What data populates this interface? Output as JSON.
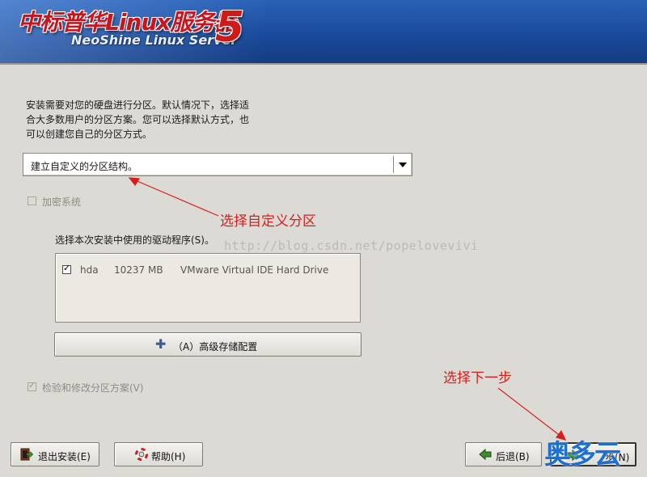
{
  "header": {
    "brand_cn": "中标普华Linux服务器",
    "brand_en": "NeoShine Linux Server",
    "version": "5"
  },
  "instructions": {
    "line1": "安装需要对您的硬盘进行分区。默认情况下，选择适",
    "line2": "合大多数用户的分区方案。您可以选择默认方式，也",
    "line3": "可以创建您自己的分区方式。"
  },
  "partition_select": {
    "selected": "建立自定义的分区结构。"
  },
  "encrypt": {
    "label": "加密系统",
    "checked": false,
    "enabled": false
  },
  "drives": {
    "label": "选择本次安装中使用的驱动程序(S)。",
    "rows": [
      {
        "checked": true,
        "name": "hda",
        "size": "10237 MB",
        "model": "VMware Virtual IDE Hard Drive"
      }
    ]
  },
  "advanced_storage": {
    "label": "（A）高级存储配置",
    "icon": "plus-icon"
  },
  "review": {
    "label": "检验和修改分区方案(V)",
    "checked": true,
    "enabled": false
  },
  "buttons": {
    "exit": {
      "label": "退出安装(E)",
      "icon": "exit-icon"
    },
    "help": {
      "label": "帮助(H)",
      "icon": "help-lifebuoy-icon"
    },
    "back": {
      "label": "后退(B)",
      "icon": "back-arrow-icon"
    },
    "next": {
      "label": "步(N)",
      "icon": "next-arrow-icon"
    }
  },
  "annotations": {
    "custom_partition": "选择自定义分区",
    "next_step": "选择下一步",
    "color": "#d61f1f"
  },
  "watermarks": {
    "url": "http://blog.csdn.net/popelovevivi",
    "logo": "奥多云"
  },
  "colors": {
    "background": "#dcdad5",
    "header_blue": "#1a4a9a",
    "brand_red": "#c8141c"
  }
}
